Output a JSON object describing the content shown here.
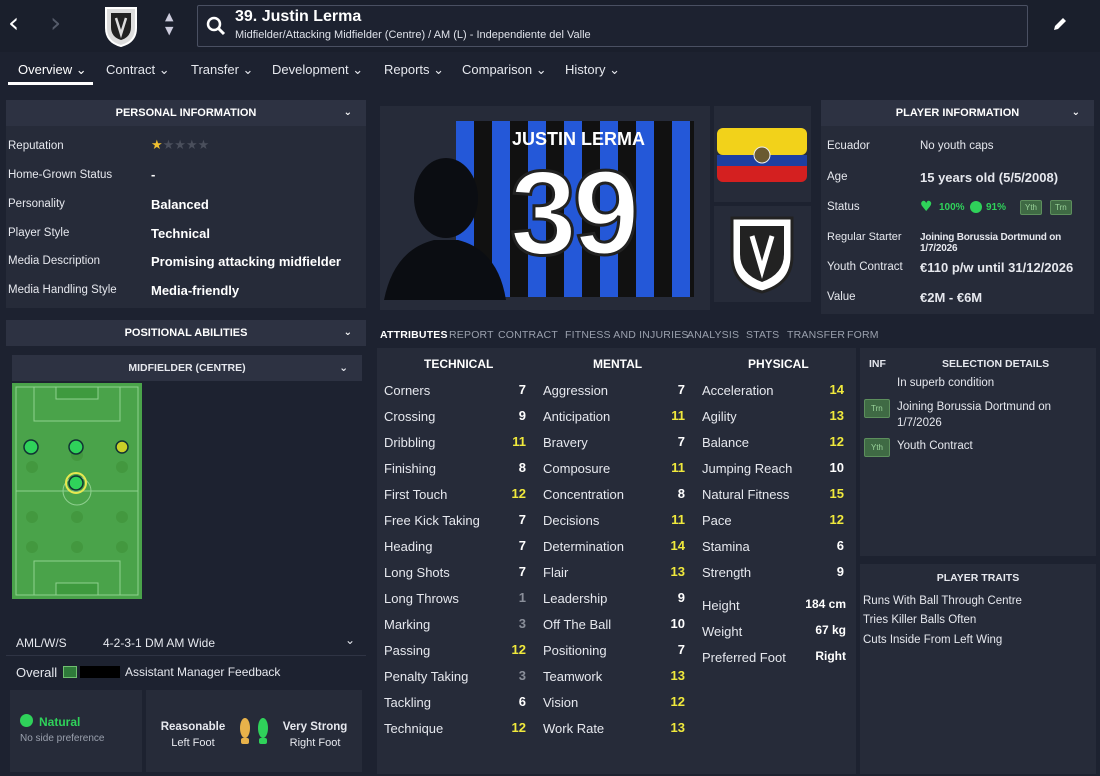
{
  "header": {
    "title": "39. Justin Lerma",
    "subtitle": "Midfielder/Attacking Midfielder (Centre) / AM (L) - Independiente del Valle"
  },
  "tabs": [
    {
      "label": "Overview"
    },
    {
      "label": "Contract"
    },
    {
      "label": "Transfer"
    },
    {
      "label": "Development"
    },
    {
      "label": "Reports"
    },
    {
      "label": "Comparison"
    },
    {
      "label": "History"
    }
  ],
  "personal": {
    "title": "PERSONAL INFORMATION",
    "rows": [
      {
        "label": "Reputation",
        "value": ""
      },
      {
        "label": "Home-Grown Status",
        "value": "-"
      },
      {
        "label": "Personality",
        "value": "Balanced"
      },
      {
        "label": "Player Style",
        "value": "Technical"
      },
      {
        "label": "Media Description",
        "value": "Promising attacking midfielder"
      },
      {
        "label": "Media Handling Style",
        "value": "Media-friendly"
      }
    ],
    "reputation_stars": 0.5
  },
  "positional": {
    "title": "POSITIONAL ABILITIES",
    "subtitle": "MIDFIELDER (CENTRE)"
  },
  "tactic": {
    "role": "AML/W/S",
    "formation": "4-2-3-1 DM AM Wide",
    "overall_label": "Overall",
    "feedback": "Assistant Manager Feedback"
  },
  "foot": {
    "natural": "Natural",
    "no_pref": "No side preference",
    "left_level": "Reasonable",
    "left_label": "Left Foot",
    "right_level": "Very Strong",
    "right_label": "Right Foot"
  },
  "card": {
    "name": "JUSTIN LERMA",
    "number": "39"
  },
  "playerinfo": {
    "title": "PLAYER INFORMATION",
    "rows": [
      {
        "label": "Ecuador",
        "value": "No youth caps"
      },
      {
        "label": "Age",
        "value": "15 years old (5/5/2008)"
      },
      {
        "label": "Status",
        "value": ""
      },
      {
        "label": "Regular Starter",
        "value": "Joining Borussia Dortmund on 1/7/2026"
      },
      {
        "label": "Youth Contract",
        "value": "€110 p/w until 31/12/2026"
      },
      {
        "label": "Value",
        "value": "€2M - €6M"
      }
    ],
    "status": {
      "condition": "100%",
      "sharpness": "91%",
      "badge1": "Yth",
      "badge2": "Trn"
    }
  },
  "subtabs": [
    "ATTRIBUTES",
    "REPORT",
    "CONTRACT",
    "FITNESS AND INJURIES",
    "ANALYSIS",
    "STATS",
    "TRANSFER",
    "FORM"
  ],
  "attributes": {
    "technical_title": "TECHNICAL",
    "mental_title": "MENTAL",
    "physical_title": "PHYSICAL",
    "technical": [
      [
        "Corners",
        "7"
      ],
      [
        "Crossing",
        "9"
      ],
      [
        "Dribbling",
        "11"
      ],
      [
        "Finishing",
        "8"
      ],
      [
        "First Touch",
        "12"
      ],
      [
        "Free Kick Taking",
        "7"
      ],
      [
        "Heading",
        "7"
      ],
      [
        "Long Shots",
        "7"
      ],
      [
        "Long Throws",
        "1"
      ],
      [
        "Marking",
        "3"
      ],
      [
        "Passing",
        "12"
      ],
      [
        "Penalty Taking",
        "3"
      ],
      [
        "Tackling",
        "6"
      ],
      [
        "Technique",
        "12"
      ]
    ],
    "mental": [
      [
        "Aggression",
        "7"
      ],
      [
        "Anticipation",
        "11"
      ],
      [
        "Bravery",
        "7"
      ],
      [
        "Composure",
        "11"
      ],
      [
        "Concentration",
        "8"
      ],
      [
        "Decisions",
        "11"
      ],
      [
        "Determination",
        "14"
      ],
      [
        "Flair",
        "13"
      ],
      [
        "Leadership",
        "9"
      ],
      [
        "Off The Ball",
        "10"
      ],
      [
        "Positioning",
        "7"
      ],
      [
        "Teamwork",
        "13"
      ],
      [
        "Vision",
        "12"
      ],
      [
        "Work Rate",
        "13"
      ]
    ],
    "physical": [
      [
        "Acceleration",
        "14"
      ],
      [
        "Agility",
        "13"
      ],
      [
        "Balance",
        "12"
      ],
      [
        "Jumping Reach",
        "10"
      ],
      [
        "Natural Fitness",
        "15"
      ],
      [
        "Pace",
        "12"
      ],
      [
        "Stamina",
        "6"
      ],
      [
        "Strength",
        "9"
      ]
    ],
    "extra": [
      [
        "Height",
        "184 cm"
      ],
      [
        "Weight",
        "67 kg"
      ],
      [
        "Preferred Foot",
        "Right"
      ]
    ]
  },
  "selection": {
    "inf": "INF",
    "title": "SELECTION DETAILS",
    "items": [
      {
        "badge": "",
        "text": "In superb condition"
      },
      {
        "badge": "Trn",
        "text": "Joining Borussia Dortmund on 1/7/2026"
      },
      {
        "badge": "Yth",
        "text": "Youth Contract"
      }
    ]
  },
  "traits": {
    "title": "PLAYER TRAITS",
    "items": [
      "Runs With Ball Through Centre",
      "Tries Killer Balls Often",
      "Cuts Inside From Left Wing"
    ]
  }
}
